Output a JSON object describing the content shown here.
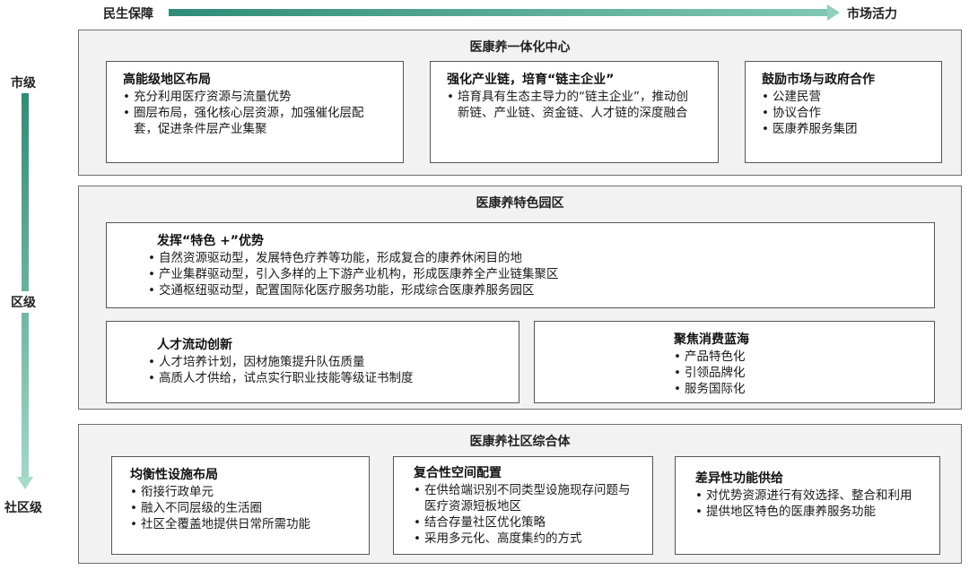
{
  "header": {
    "left_label": "民生保障",
    "right_label": "市场活力"
  },
  "levels": {
    "top": "市级",
    "middle": "区级",
    "bottom": "社区级"
  },
  "sections": [
    {
      "title": "医康养一体化中心",
      "cards": [
        {
          "title": "高能级地区布局",
          "items": [
            "充分利用医疗资源与流量优势",
            "圈层布局，强化核心层资源，加强催化层配套，促进条件层产业集聚"
          ]
        },
        {
          "title": "强化产业链，培育“链主企业”",
          "items": [
            "培育具有生态主导力的“链主企业”，推动创新链、产业链、资金链、人才链的深度融合"
          ]
        },
        {
          "title": "鼓励市场与政府合作",
          "items": [
            "公建民营",
            "协议合作",
            "医康养服务集团"
          ]
        }
      ]
    },
    {
      "title": "医康养特色园区",
      "cards": [
        {
          "title": "发挥“特色 +”优势",
          "items": [
            "自然资源驱动型，发展特色疗养等功能，形成复合的康养休闲目的地",
            "产业集群驱动型，引入多样的上下游产业机构，形成医康养全产业链集聚区",
            "交通枢纽驱动型，配置国际化医疗服务功能，形成综合医康养服务园区"
          ]
        },
        {
          "title": "人才流动创新",
          "items": [
            "人才培养计划，因材施策提升队伍质量",
            "高质人才供给，试点实行职业技能等级证书制度"
          ]
        },
        {
          "title": "聚焦消费蓝海",
          "items": [
            "产品特色化",
            "引领品牌化",
            "服务国际化"
          ]
        }
      ]
    },
    {
      "title": "医康养社区综合体",
      "cards": [
        {
          "title": "均衡性设施布局",
          "items": [
            "衔接行政单元",
            "融入不同层级的生活圈",
            "社区全覆盖地提供日常所需功能"
          ]
        },
        {
          "title": "复合性空间配置",
          "items": [
            "在供给端识别不同类型设施现存问题与医疗资源短板地区",
            "结合存量社区优化策略",
            "采用多元化、高度集约的方式"
          ]
        },
        {
          "title": "差异性功能供给",
          "items": [
            "对优势资源进行有效选择、整合和利用",
            "提供地区特色的医康养服务功能"
          ]
        }
      ]
    }
  ]
}
